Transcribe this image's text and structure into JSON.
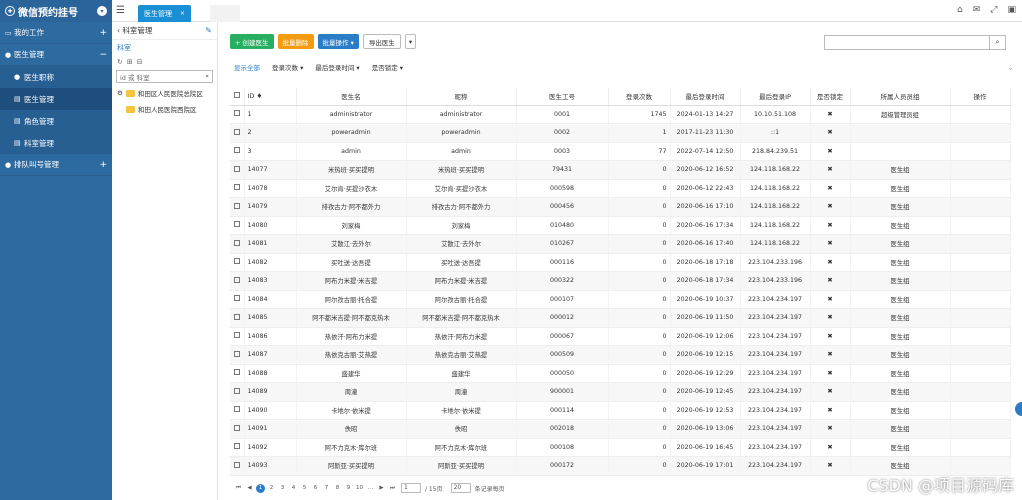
{
  "app": {
    "title": "微信预约挂号"
  },
  "menu": [
    {
      "label": "我的工作",
      "toggle": "+"
    },
    {
      "label": "医生管理",
      "toggle": "−"
    },
    {
      "label": "排队叫号管理",
      "toggle": "+"
    }
  ],
  "submenu": [
    "医生职称",
    "医生管理",
    "角色管理",
    "科室管理"
  ],
  "tab": {
    "label": "医生管理"
  },
  "tree": {
    "title": "科室管理",
    "subtab": "科室",
    "search_placeholder": "id 或 科室",
    "nodes": [
      "和田区人民医院总院区",
      "和田人民医院西院区"
    ]
  },
  "toolbar": {
    "create": "+ 创建医生",
    "batch_delete": "批量删除",
    "batch_ops": "批量操作 ▾",
    "export": "导出医生",
    "caret": "▾"
  },
  "filters": [
    "显示全部",
    "登录次数 ▾",
    "最后登录时间 ▾",
    "是否锁定 ▾"
  ],
  "table": {
    "headers": [
      "",
      "ID ♦",
      "医生名",
      "昵称",
      "医生工号",
      "登录次数",
      "最后登录时间",
      "最后登录IP",
      "是否锁定",
      "所属人员员组",
      "操作"
    ],
    "rows": [
      [
        "1",
        "administrator",
        "administrator",
        "0001",
        "1745",
        "2024-01-13 14:27",
        "10.10.51.108",
        "✖",
        "超级管理员组"
      ],
      [
        "2",
        "poweradmin",
        "poweradmin",
        "0002",
        "1",
        "2017-11-23 11:30",
        "::1",
        "✖",
        ""
      ],
      [
        "3",
        "admin",
        "admin",
        "0003",
        "77",
        "2022-07-14 12:50",
        "218.84.239.51",
        "✖",
        ""
      ],
      [
        "14077",
        "米热班·买买提明",
        "米热班·买买提明",
        "79431",
        "0",
        "2020-06-12 16:52",
        "124.118.168.22",
        "✖",
        "医生组"
      ],
      [
        "14078",
        "艾尔肯·买提沙衣木",
        "艾尔肯·买提沙衣木",
        "000598",
        "0",
        "2020-06-12 22:43",
        "124.118.168.22",
        "✖",
        "医生组"
      ],
      [
        "14079",
        "排孜古力·阿不都外力",
        "排孜古力·阿不都外力",
        "000456",
        "0",
        "2020-06-16 17:10",
        "124.118.168.22",
        "✖",
        "医生组"
      ],
      [
        "14080",
        "刘家梅",
        "刘家梅",
        "010480",
        "0",
        "2020-06-16 17:34",
        "124.118.168.22",
        "✖",
        "医生组"
      ],
      [
        "14081",
        "艾散江·去外尔",
        "艾散江·去外尔",
        "010267",
        "0",
        "2020-06-16 17:40",
        "124.118.168.22",
        "✖",
        "医生组"
      ],
      [
        "14082",
        "买吐送·达吾提",
        "买吐送·达吾提",
        "000116",
        "0",
        "2020-06-18 17:18",
        "223.104.233.196",
        "✖",
        "医生组"
      ],
      [
        "14083",
        "阿布力米提·米吉提",
        "阿布力米提·米吉提",
        "000322",
        "0",
        "2020-06-18 17:34",
        "223.104.233.196",
        "✖",
        "医生组"
      ],
      [
        "14084",
        "阿尔孜古丽·托合提",
        "阿尔孜古丽·托合提",
        "000107",
        "0",
        "2020-06-19 10:37",
        "223.104.234.197",
        "✖",
        "医生组"
      ],
      [
        "14085",
        "阿不都米吉提·阿不都克热木",
        "阿不都米吉提·阿不都克热木",
        "000012",
        "0",
        "2020-06-19 11:50",
        "223.104.234.197",
        "✖",
        "医生组"
      ],
      [
        "14086",
        "热依汗·阿布力米提",
        "热依汗·阿布力米提",
        "000067",
        "0",
        "2020-06-19 12:06",
        "223.104.234.197",
        "✖",
        "医生组"
      ],
      [
        "14087",
        "热依克古丽·艾热提",
        "热依克古丽·艾热提",
        "000509",
        "0",
        "2020-06-19 12:15",
        "223.104.234.197",
        "✖",
        "医生组"
      ],
      [
        "14088",
        "盛建华",
        "盛建华",
        "000050",
        "0",
        "2020-06-19 12:29",
        "223.104.234.197",
        "✖",
        "医生组"
      ],
      [
        "14089",
        "周潼",
        "周潼",
        "900001",
        "0",
        "2020-06-19 12:45",
        "223.104.234.197",
        "✖",
        "医生组"
      ],
      [
        "14090",
        "卡地尔·依米提",
        "卡地尔·依米提",
        "000114",
        "0",
        "2020-06-19 12:53",
        "223.104.234.197",
        "✖",
        "医生组"
      ],
      [
        "14091",
        "佚昭",
        "佚昭",
        "002018",
        "0",
        "2020-06-19 13:06",
        "223.104.234.197",
        "✖",
        "医生组"
      ],
      [
        "14092",
        "阿不力克木·库尔班",
        "阿不力克木·库尔班",
        "000108",
        "0",
        "2020-06-19 16:45",
        "223.104.234.197",
        "✖",
        "医生组"
      ],
      [
        "14093",
        "阿斯亚·买买提明",
        "阿斯亚·买买提明",
        "000172",
        "0",
        "2020-06-19 17:01",
        "223.104.234.197",
        "✖",
        "医生组"
      ]
    ]
  },
  "pager": {
    "pages": [
      "1",
      "2",
      "3",
      "4",
      "5",
      "6",
      "7",
      "8",
      "9",
      "10"
    ],
    "current": "1",
    "first": "⏮",
    "prev": "◀",
    "next": "▶",
    "last": "⏭",
    "page_input": "1",
    "total": "/ 15页",
    "page_size": "20",
    "size_label": "条记录每页"
  },
  "watermark": "CSDN @项目源码库"
}
